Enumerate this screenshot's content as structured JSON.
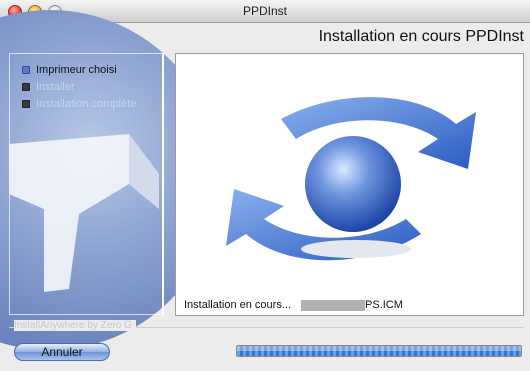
{
  "window": {
    "title": "PPDInst"
  },
  "header": {
    "heading": "Installation en cours PPDInst"
  },
  "sidebar": {
    "steps": [
      {
        "label": "Imprimeur choisi",
        "state": "active"
      },
      {
        "label": "Installer",
        "state": "inactive"
      },
      {
        "label": "Installation complète",
        "state": "inactive"
      }
    ]
  },
  "main": {
    "status_prefix": "Installation en cours...",
    "status_file": "PS.ICM"
  },
  "footer": {
    "brand": "InstallAnywhere by Zero G",
    "cancel_label": "Annuler"
  },
  "progress": {
    "value": 1.0
  },
  "colors": {
    "accent": "#5a78c8",
    "progress": "#3a74d2"
  }
}
